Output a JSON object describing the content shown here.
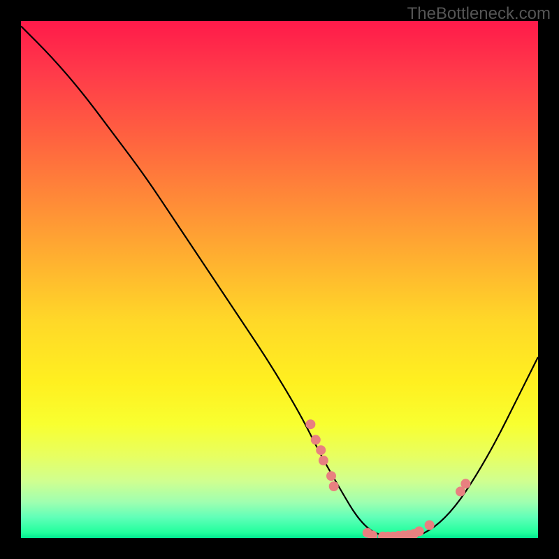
{
  "watermark": "TheBottleneck.com",
  "chart_data": {
    "type": "line",
    "title": "",
    "xlabel": "",
    "ylabel": "",
    "xlim": [
      0,
      100
    ],
    "ylim": [
      0,
      100
    ],
    "curve_points": {
      "x": [
        0,
        6,
        12,
        18,
        24,
        30,
        36,
        42,
        48,
        54,
        58,
        62,
        65,
        68,
        72,
        76,
        80,
        84,
        88,
        92,
        96,
        100
      ],
      "y": [
        99,
        93,
        86,
        78,
        70,
        61,
        52,
        43,
        34,
        24,
        16,
        9,
        4,
        1,
        0,
        0,
        2,
        6,
        12,
        19,
        27,
        35
      ]
    },
    "dot_clusters": [
      {
        "x": 56,
        "y": 22,
        "color": "#e88080"
      },
      {
        "x": 57,
        "y": 19,
        "color": "#e88080"
      },
      {
        "x": 58,
        "y": 17,
        "color": "#e88080"
      },
      {
        "x": 58.5,
        "y": 15,
        "color": "#e88080"
      },
      {
        "x": 60,
        "y": 12,
        "color": "#e88080"
      },
      {
        "x": 60.5,
        "y": 10,
        "color": "#e88080"
      },
      {
        "x": 67,
        "y": 1,
        "color": "#e88080"
      },
      {
        "x": 68,
        "y": 0.5,
        "color": "#e88080"
      },
      {
        "x": 70,
        "y": 0.3,
        "color": "#e88080"
      },
      {
        "x": 71,
        "y": 0.3,
        "color": "#e88080"
      },
      {
        "x": 72,
        "y": 0.3,
        "color": "#e88080"
      },
      {
        "x": 73,
        "y": 0.4,
        "color": "#e88080"
      },
      {
        "x": 74,
        "y": 0.5,
        "color": "#e88080"
      },
      {
        "x": 75,
        "y": 0.6,
        "color": "#e88080"
      },
      {
        "x": 76,
        "y": 0.8,
        "color": "#e88080"
      },
      {
        "x": 77,
        "y": 1.3,
        "color": "#e88080"
      },
      {
        "x": 79,
        "y": 2.5,
        "color": "#e88080"
      },
      {
        "x": 85,
        "y": 9,
        "color": "#e88080"
      },
      {
        "x": 86,
        "y": 10.5,
        "color": "#e88080"
      }
    ],
    "gradient_colors": {
      "top": "#ff1a4a",
      "upper_mid": "#ffb030",
      "mid": "#fff020",
      "lower_mid": "#d0ff90",
      "bottom": "#00e890"
    }
  }
}
